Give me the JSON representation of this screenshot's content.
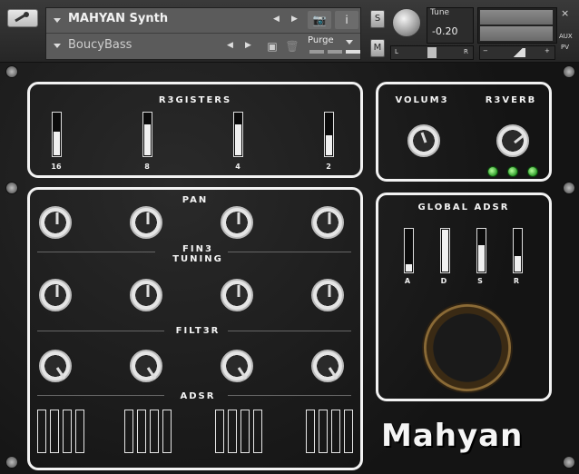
{
  "header": {
    "instrument_name": "MAHYAN Synth",
    "patch_name": "BoucyBass",
    "purge_label": "Purge",
    "s_label": "S",
    "m_label": "M",
    "tune_label": "Tune",
    "tune_value": "-0.20",
    "pan_left": "L",
    "pan_right": "R",
    "vol_minus": "−",
    "vol_plus": "+",
    "close_label": "×",
    "aux_label": "AUX",
    "pv_label": "PV"
  },
  "registers": {
    "title": "R3GISTERS",
    "sliders": [
      {
        "label": "16",
        "level": 0.55
      },
      {
        "label": "8",
        "level": 0.7
      },
      {
        "label": "4",
        "level": 0.7
      },
      {
        "label": "2",
        "level": 0.45
      }
    ]
  },
  "volume": {
    "title": "VOLUM3"
  },
  "reverb": {
    "title": "R3VERB",
    "leds": 3
  },
  "sections": {
    "pan": "PAN",
    "fine_tuning": "FIN3\nTUNING",
    "filter": "FILT3R",
    "adsr": "ADSR"
  },
  "global_adsr": {
    "title": "GLOBAL ADSR",
    "bars": [
      {
        "label": "A",
        "level": 0.15
      },
      {
        "label": "D",
        "level": 1.0
      },
      {
        "label": "S",
        "level": 0.6
      },
      {
        "label": "R",
        "level": 0.35
      }
    ]
  },
  "logo": "Mahyan"
}
